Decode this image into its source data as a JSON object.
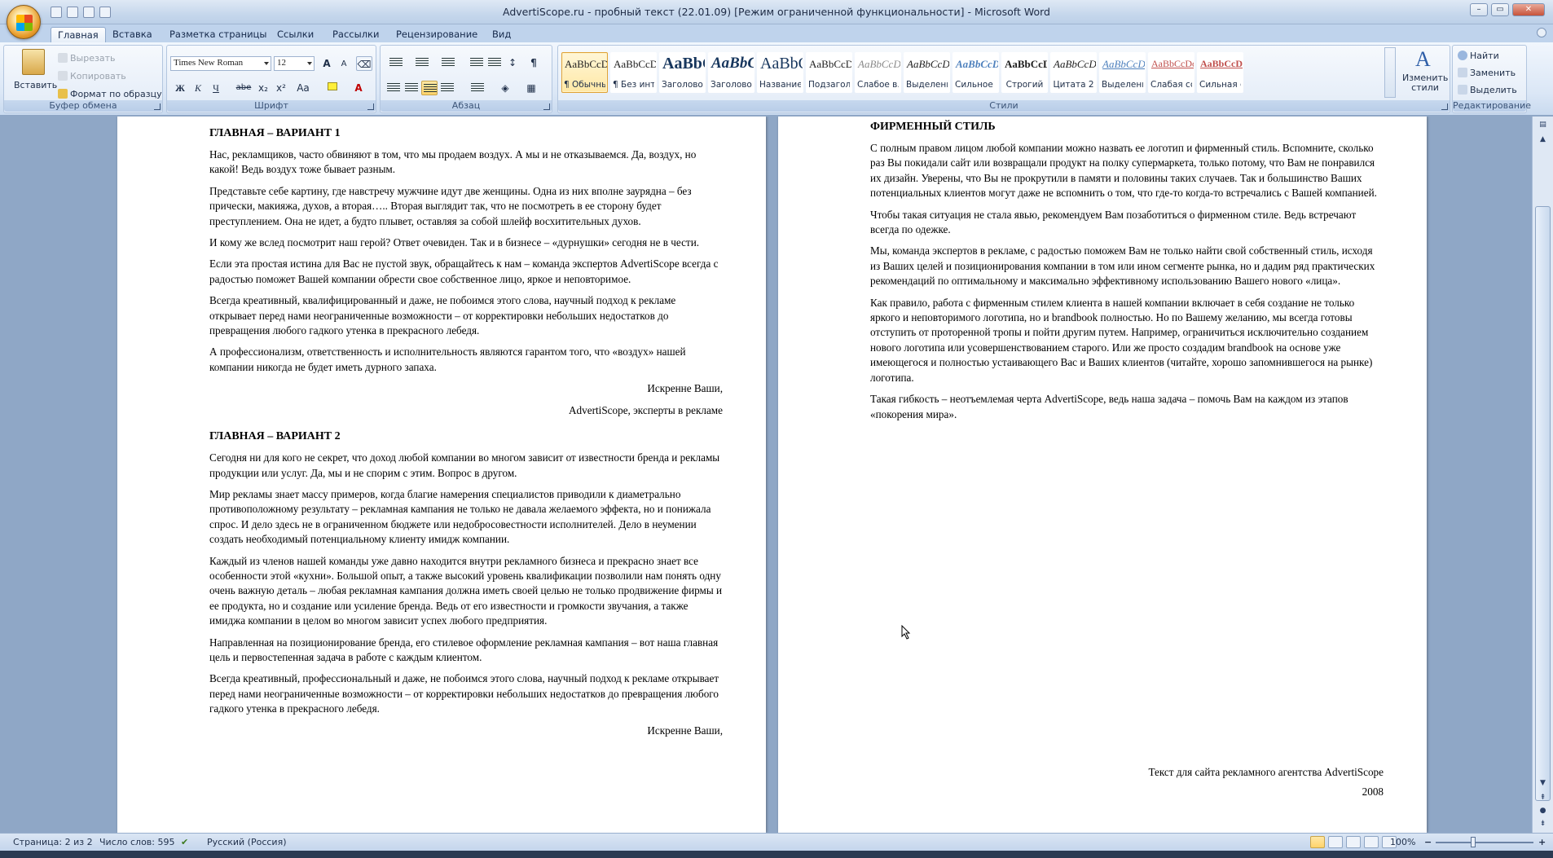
{
  "window": {
    "title": "AdvertiScope.ru - пробный текст (22.01.09) [Режим ограниченной функциональности] - Microsoft Word",
    "controls": [
      "–",
      "▭",
      "✕"
    ]
  },
  "tabs": [
    {
      "label": "Главная",
      "active": true
    },
    {
      "label": "Вставка"
    },
    {
      "label": "Разметка страницы"
    },
    {
      "label": "Ссылки"
    },
    {
      "label": "Рассылки"
    },
    {
      "label": "Рецензирование"
    },
    {
      "label": "Вид"
    }
  ],
  "clipboard": {
    "paste": "Вставить",
    "cut": "Вырезать",
    "copy": "Копировать",
    "format_painter": "Формат по образцу",
    "label": "Буфер обмена"
  },
  "font": {
    "name": "Times New Roman",
    "size": "12",
    "label": "Шрифт",
    "buttons": [
      "Ж",
      "К",
      "Ч",
      "abe",
      "x₂",
      "x²",
      "Aa"
    ],
    "grow": "A",
    "shrink": "A"
  },
  "paragraph": {
    "label": "Абзац"
  },
  "styles": {
    "label": "Стили",
    "change_label": "Изменить стили",
    "items": [
      {
        "sample": "AaBbCcDc",
        "name": "¶ Обычный",
        "selected": true
      },
      {
        "sample": "AaBbCcDc",
        "name": "¶ Без инте..."
      },
      {
        "sample": "AaBbC",
        "name": "Заголово..."
      },
      {
        "sample": "AaBbCc",
        "name": "Заголово..."
      },
      {
        "sample": "AaBbC",
        "name": "Название"
      },
      {
        "sample": "AaBbCcD",
        "name": "Подзагол..."
      },
      {
        "sample": "AaBbCcDc",
        "name": "Слабое в..."
      },
      {
        "sample": "AaBbCcDc",
        "name": "Выделение"
      },
      {
        "sample": "AaBbCcDc",
        "name": "Сильное ..."
      },
      {
        "sample": "AaBbCcDc",
        "name": "Строгий"
      },
      {
        "sample": "AaBbCcDc",
        "name": "Цитата 2"
      },
      {
        "sample": "AaBbCcDc",
        "name": "Выделенн..."
      },
      {
        "sample": "AaBbCcDc",
        "name": "Слабая сс..."
      },
      {
        "sample": "AaBbCcDc",
        "name": "Сильная с..."
      }
    ]
  },
  "editing": {
    "label": "Редактирование",
    "find": "Найти",
    "replace": "Заменить",
    "select": "Выделить"
  },
  "page1": {
    "h1": "ГЛАВНАЯ – ВАРИАНТ 1",
    "p1": "Нас, рекламщиков, часто обвиняют в том, что мы продаем воздух. А мы и не отказываемся. Да, воздух, но какой! Ведь воздух тоже бывает разным.",
    "p2": "Представьте себе картину, где навстречу мужчине идут две женщины. Одна из них вполне заурядна – без прически, макияжа, духов, а вторая….. Вторая выглядит так, что не посмотреть в ее сторону будет преступлением. Она не идет, а будто плывет, оставляя за собой шлейф восхитительных духов.",
    "p3": "И кому же вслед посмотрит наш герой? Ответ очевиден. Так и в бизнесе – «дурнушки» сегодня не в чести.",
    "p4": "Если эта простая истина для Вас не пустой звук, обращайтесь к нам – команда экспертов AdvertiScope всегда с радостью поможет Вашей компании обрести свое собственное лицо, яркое и неповторимое.",
    "p5": "Всегда креативный, квалифицированный и даже, не побоимся этого слова, научный подход к рекламе  открывает перед нами неограниченные возможности – от корректировки небольших недостатков до превращения любого гадкого утенка в прекрасного лебедя.",
    "p6": "А профессионализм, ответственность и исполнительность являются гарантом того, что «воздух» нашей компании никогда не будет иметь дурного запаха.",
    "sign1": "Искренне Ваши,",
    "sign2": "AdvertiScope, эксперты в рекламе",
    "h2": "ГЛАВНАЯ – ВАРИАНТ 2",
    "q1": "Сегодня ни для кого не секрет, что доход любой компании во многом зависит от известности бренда и рекламы продукции или услуг. Да, мы и не спорим с этим. Вопрос в другом.",
    "q2": "Мир рекламы знает массу примеров, когда благие намерения специалистов приводили к диаметрально противоположному результату – рекламная кампания не только не давала желаемого эффекта, но и понижала спрос. И дело здесь не в ограниченном бюджете или недобросовестности исполнителей. Дело в неумении создать необходимый потенциальному клиенту имидж компании.",
    "q3": "Каждый из членов нашей команды уже давно находится внутри рекламного бизнеса и прекрасно знает все особенности этой «кухни». Большой опыт, а также высокий уровень квалификации позволили нам понять одну очень важную деталь – любая рекламная кампания должна иметь своей целью не только продвижение фирмы и ее продукта, но и создание или усиление бренда. Ведь от его известности и громкости звучания, а также имиджа компании в целом во многом зависит успех любого предприятия.",
    "q4": "Направленная на позиционирование бренда, его стилевое оформление рекламная кампания – вот наша главная цель и первостепенная задача в работе с каждым клиентом.",
    "q5": "Всегда креативный, профессиональный и даже, не побоимся этого слова, научный подход к рекламе  открывает перед нами неограниченные возможности – от корректировки небольших недостатков до  превращения любого гадкого утенка в прекрасного лебедя.",
    "sign3": "Искренне Ваши,"
  },
  "page2": {
    "h": "ФИРМЕННЫЙ СТИЛЬ",
    "p1": "С полным правом лицом любой компании можно назвать ее логотип и фирменный стиль. Вспомните, сколько раз Вы покидали сайт или возвращали продукт на полку супермаркета, только потому, что Вам не понравился их дизайн. Уверены, что Вы не прокрутили в памяти и половины таких случаев. Так и большинство Ваших потенциальных клиентов могут даже не вспомнить о том, что где-то когда-то встречались с Вашей компанией.",
    "p2": "Чтобы такая ситуация не стала явью, рекомендуем Вам позаботиться о фирменном стиле. Ведь встречают всегда по одежке.",
    "p3": "Мы, команда экспертов в рекламе,  с радостью поможем Вам не только найти свой собственный стиль, исходя из Ваших целей и позиционирования компании в том или ином сегменте рынка, но и дадим ряд практических рекомендаций по оптимальному и максимально эффективному использованию Вашего нового «лица».",
    "p4": "Как правило, работа с фирменным стилем клиента в нашей компании включает в себя создание не только яркого и неповторимого логотипа, но и brandbook полностью. Но по Вашему желанию, мы всегда готовы отступить от проторенной тропы и пойти другим путем. Например, ограничиться исключительно созданием нового логотипа или усовершенствованием старого. Или же просто создадим brandbook на основе уже имеющегося и полностью устаивающего Вас и Ваших клиентов (читайте, хорошо запомнившегося на рынке) логотипа.",
    "p5": "Такая гибкость – неотъемлемая черта  AdvertiScope, ведь наша задача – помочь Вам на каждом из этапов «покорения мира».",
    "footer1": "Текст для сайта рекламного агентства AdvertiScope",
    "footer2": "2008"
  },
  "status": {
    "page": "Страница: 2 из 2",
    "words": "Число слов: 595",
    "language": "Русский (Россия)",
    "zoom": "100%",
    "minus": "−",
    "plus": "+"
  }
}
